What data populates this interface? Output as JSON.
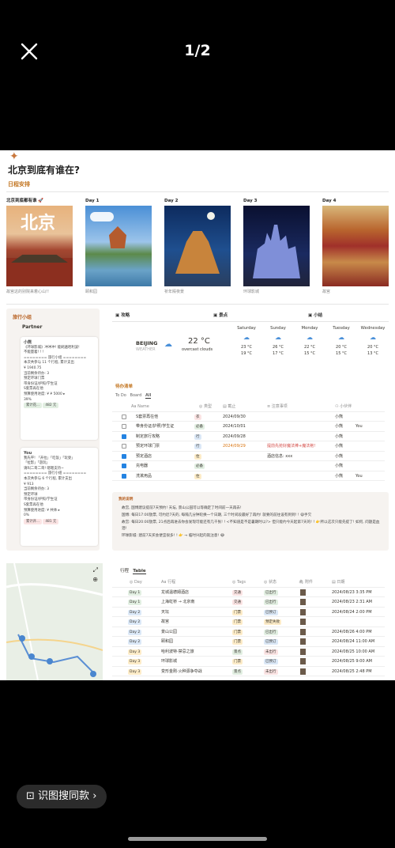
{
  "viewer": {
    "counter": "1/2",
    "search_pill": "识图搜同款"
  },
  "page": {
    "title": "北京到底有谁在?",
    "subtitle": "日程安排"
  },
  "gallery": [
    {
      "label": "北京到底都有谁 🚀",
      "caption": "故宫这的别院来着心山!!",
      "overlay": "北京"
    },
    {
      "label": "Day 1",
      "caption": "颐和园",
      "overlay": ""
    },
    {
      "label": "Day 2",
      "caption": "祈年殿夜景",
      "overlay": ""
    },
    {
      "label": "Day 3",
      "caption": "环球影城",
      "overlay": ""
    },
    {
      "label": "Day 4",
      "caption": "故宫",
      "overlay": ""
    }
  ],
  "sidebar": {
    "title": "旅行小组",
    "partners": "Partner",
    "cards": [
      {
        "name": "小熊",
        "l1": "《环球影城》冲冲冲! 能刷遍哈利波!",
        "l2": "不能量着! ! !",
        "l3": "======== 旅行小组 ========",
        "l4": "本次共参与 11 个行程, 累计支出",
        "l5": "¥ 1940.75",
        "l6": "当前剩余待办: 3",
        "l7": "预定环球门票",
        "l8": "带身份证/护照/学生证",
        "l9": "S套票再在他",
        "l10": "预算使用进度: ¥ ¥ 5000 ▸",
        "l11": "39%",
        "b1": "累计花...",
        "b2": "482 元"
      },
      {
        "name": "You",
        "l1": "我先平! 「开拉」「吃饭」「玩耍」",
        "l2": "「拉影」「遊玩」",
        "l3": "请叫二哥二哥! 嗯嗯支持~",
        "l4": "======== 旅行小组 ========",
        "l5": "本次共参与 6 个行程, 累计支出",
        "l6": "¥ 913",
        "l7": "当前剩余待办: 3",
        "l8": "预定环球",
        "l9": "带身份证/护照/学生证",
        "l10": "S套票再在他",
        "l11": "预算使用进度: ¥ 共体 ▸",
        "l12": "0%",
        "b1": "累计开...",
        "b2": "481 元"
      }
    ]
  },
  "headers": {
    "strategy": "攻略",
    "spots": "景点",
    "tips": "小结"
  },
  "weather": {
    "city": "BEIJING",
    "city_sub": "WEATHER",
    "temp": "22 °C",
    "desc": "overcast clouds",
    "days": [
      {
        "d": "Saturday",
        "h": "23 °C",
        "l": "19 °C"
      },
      {
        "d": "Sunday",
        "h": "26 °C",
        "l": "17 °C"
      },
      {
        "d": "Monday",
        "h": "22 °C",
        "l": "15 °C"
      },
      {
        "d": "Tuesday",
        "h": "20 °C",
        "l": "15 °C"
      },
      {
        "d": "Wednesday",
        "h": "20 °C",
        "l": "13 °C"
      }
    ]
  },
  "todo": {
    "title": "待办清单",
    "tabs": [
      "To Do",
      "Board",
      "All"
    ],
    "cols": [
      "Aa Name",
      "◎ 类型",
      "▤ 截止",
      "≡ 注意事项",
      "⚇ 小伙伴"
    ],
    "rows": [
      {
        "n": "S套票再在他",
        "t": "衣",
        "d": "2024/09/30",
        "note": "",
        "who": "小熊",
        "who2": "",
        "done": false
      },
      {
        "n": "带身份证/护照/学生证",
        "t": "必备",
        "d": "2024/10/01",
        "note": "",
        "who": "小熊",
        "who2": "You",
        "done": false
      },
      {
        "n": "制定旅行攻略",
        "t": "行",
        "d": "2024/09/28",
        "note": "",
        "who": "小熊",
        "who2": "",
        "done": true
      },
      {
        "n": "预定环球门票",
        "t": "行",
        "d": "2024/09/29",
        "note": "提前先抢好魔法棒+魔法袍!",
        "who": "小熊",
        "who2": "",
        "done": false
      },
      {
        "n": "预定酒店",
        "t": "住",
        "d": "",
        "note": "酒店信息: xxx",
        "who": "小熊",
        "who2": "",
        "done": true
      },
      {
        "n": "充电器",
        "t": "必备",
        "d": "",
        "note": "",
        "who": "小熊",
        "who2": "",
        "done": true
      },
      {
        "n": "洗漱用品",
        "t": "住",
        "d": "",
        "note": "",
        "who": "小熊",
        "who2": "You",
        "done": true
      }
    ]
  },
  "notes": {
    "title": "我的说明",
    "lines": [
      "故宫, 国博建议提前7天预约! 天坛, 景山公园可以等确定了时间前一天再去!",
      "国博: 每日17:00放票, 可约近7天的, 每隔几分钟轮换一个日期, 三个时间段最好了再约! 就要的前往设有到到! ! 😄手欠",
      "故宫: 每日20:00放票, 21点后再进去你会发现可能还有几千张! ! <不知道是不是暑期时以?> 但只能约今天起第7天的! ! 👉所以这次只能先提了! 如何, 问题是血泪!",
      "环球影城: 建前7天买会便宜很多! ! 👉 → 临时兴起的就注意! 😂"
    ]
  },
  "itinerary": {
    "tabs": [
      "行程",
      "Table"
    ],
    "cols": [
      "◎ Day",
      "Aa 行程",
      "◎ Tags",
      "◎ 状态",
      "🖇 附件",
      "▤ 日期"
    ],
    "rows": [
      {
        "day": "Day 1",
        "name": "龙城温德姆酒店",
        "tag": "交通",
        "st": "已出行",
        "date": "2024/08/23 3:35 PM"
      },
      {
        "day": "Day 1",
        "name": "上海虹桥 → 北京南",
        "tag": "交通",
        "st": "已出行",
        "date": "2024/08/23 2:31 AM"
      },
      {
        "day": "Day 2",
        "name": "天坛",
        "tag": "门票",
        "st": "已预订",
        "date": "2024/08/24 2:00 PM"
      },
      {
        "day": "Day 2",
        "name": "故宫",
        "tag": "门票",
        "st": "预定失败",
        "date": ""
      },
      {
        "day": "Day 2",
        "name": "景山公园",
        "tag": "门票",
        "st": "已出行",
        "date": "2024/08/26 4:00 PM"
      },
      {
        "day": "Day 2",
        "name": "颐和园",
        "tag": "门票",
        "st": "已预订",
        "date": "2024/08/24 11:00 AM"
      },
      {
        "day": "Day 3",
        "name": "哈利波特·禁忌之旅",
        "tag": "景点",
        "st": "未出行",
        "date": "2024/08/25 10:00 AM"
      },
      {
        "day": "Day 3",
        "name": "环球影城",
        "tag": "门票",
        "st": "已预订",
        "date": "2024/08/25 9:00 AM"
      },
      {
        "day": "Day 3",
        "name": "变形金刚·火种源争夺战",
        "tag": "景点",
        "st": "未出行",
        "date": "2024/08/25 2:48 PM"
      }
    ]
  }
}
